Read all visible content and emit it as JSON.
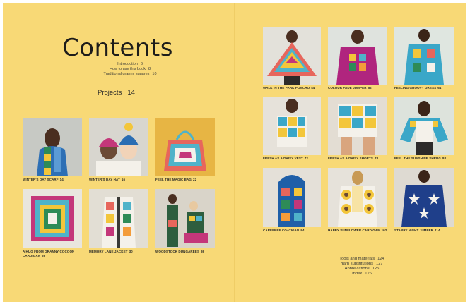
{
  "title": "Contents",
  "front_matter": [
    {
      "label": "Introduction",
      "page": "6"
    },
    {
      "label": "How to use this book",
      "page": "8"
    },
    {
      "label": "Traditional granny squares",
      "page": "10"
    }
  ],
  "projects_heading": {
    "label": "Projects",
    "page": "14"
  },
  "projects": [
    {
      "label": "WINTER'S DAY SCARF",
      "page": "14"
    },
    {
      "label": "WINTER'S DAY HAT",
      "page": "16"
    },
    {
      "label": "FEEL THE MAGIC BAG",
      "page": "22"
    },
    {
      "label": "A HUG FROM GRANNY COCOON CARDIGAN",
      "page": "26"
    },
    {
      "label": "MEMORY LANE JACKET",
      "page": "30"
    },
    {
      "label": "WOODSTOCK DUNGAREES",
      "page": "36"
    },
    {
      "label": "WALK IN THE PARK PONCHO",
      "page": "44"
    },
    {
      "label": "COLOUR FADE JUMPER",
      "page": "52"
    },
    {
      "label": "FEELING GROOVY DRESS",
      "page": "64"
    },
    {
      "label": "FRESH AS A DAISY VEST",
      "page": "72"
    },
    {
      "label": "FRESH AS A DAISY SHORTS",
      "page": "78"
    },
    {
      "label": "FEEL THE SUNSHINE SHRUG",
      "page": "84"
    },
    {
      "label": "CAREFREE COATIGAN",
      "page": "94"
    },
    {
      "label": "HAPPY SUNFLOWER CARDIGAN",
      "page": "102"
    },
    {
      "label": "STARRY NIGHT JUMPER",
      "page": "114"
    }
  ],
  "back_matter": [
    {
      "label": "Tools and materials",
      "page": "124"
    },
    {
      "label": "Yarn substitutions",
      "page": "127"
    },
    {
      "label": "Abbreviations",
      "page": "125"
    },
    {
      "label": "Index",
      "page": "126"
    }
  ],
  "colors": {
    "page_background": "#f8d976",
    "text": "#1d1c1a"
  }
}
